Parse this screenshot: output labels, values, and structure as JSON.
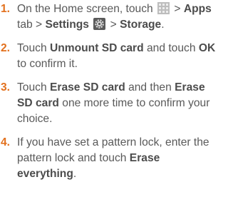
{
  "step_numbers": [
    "1.",
    "2.",
    "3.",
    "4."
  ],
  "steps": [
    {
      "t1": "On the Home screen, touch",
      "t2": ">",
      "h1": "Apps",
      "t3": "tab >",
      "h2": "Settings",
      "t4": ">",
      "h3": "Storage",
      "t5": ".",
      "icon1": "apps-grid-icon",
      "icon2": "settings-gear-icon"
    },
    {
      "t1": "Touch",
      "h1": "Unmount SD card",
      "t2": "and touch",
      "h2": "OK",
      "t3": "to confirm it."
    },
    {
      "t1": "Touch",
      "h1": "Erase SD card",
      "t2": "and then",
      "h2": "Erase SD card",
      "t3": "one more time to confirm your choice."
    },
    {
      "t1": "If you have set a pattern lock, enter the pattern lock and touch",
      "h1": "Erase everything",
      "t2": "."
    }
  ],
  "colors": {
    "number": "#e2701d",
    "text": "#595959",
    "highlight": "#4c4c4c"
  }
}
